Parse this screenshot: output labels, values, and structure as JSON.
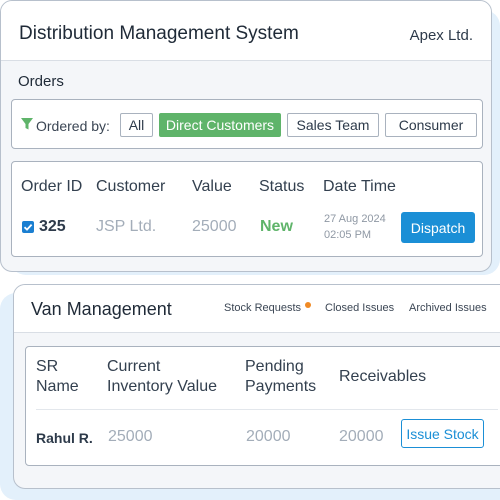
{
  "app": {
    "title": "Distribution Management System",
    "company": "Apex Ltd."
  },
  "orders": {
    "section_title": "Orders",
    "filter": {
      "label": "Ordered by:",
      "icon": "filter-icon",
      "options": [
        "All",
        "Direct Customers",
        "Sales Team",
        "Consumer"
      ],
      "selected": "Direct Customers"
    },
    "columns": [
      "Order ID",
      "Customer",
      "Value",
      "Status",
      "Date Time"
    ],
    "rows": [
      {
        "checked": true,
        "order_id": "325",
        "customer": "JSP Ltd.",
        "value": "25000",
        "status": "New",
        "date": "27 Aug 2024",
        "time": "02:05 PM",
        "action": "Dispatch"
      }
    ]
  },
  "van": {
    "title": "Van Management",
    "tabs": [
      "Stock Requests",
      "Closed Issues",
      "Archived Issues"
    ],
    "columns": {
      "sr_name": [
        "SR",
        "Name"
      ],
      "current_inventory": [
        "Current",
        "Inventory Value"
      ],
      "pending_payments": [
        "Pending",
        "Payments"
      ],
      "receivables": "Receivables"
    },
    "rows": [
      {
        "sr_name": "Rahul R.",
        "current_inventory": "25000",
        "pending_payments": "20000",
        "receivables": "20000",
        "action": "Issue Stock"
      }
    ]
  },
  "colors": {
    "accent_blue": "#1b8fd6",
    "active_green": "#5fb46a",
    "notification_orange": "#f08a24",
    "background_band": "#e3f0fb"
  }
}
